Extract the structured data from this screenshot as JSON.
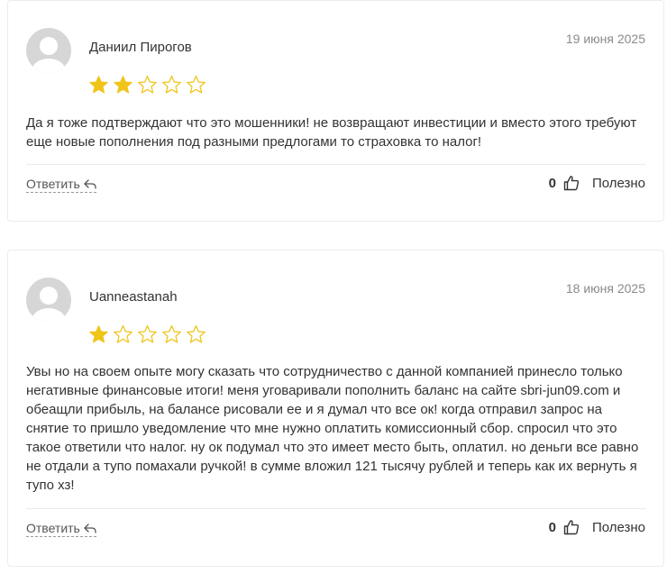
{
  "colors": {
    "star_filled": "#f0c419",
    "star_empty_stroke": "#f0c419",
    "avatar_bg": "#d6d6d6",
    "avatar_fg": "#ffffff"
  },
  "reviews": [
    {
      "author": "Даниил Пирогов",
      "date": "19 июня 2025",
      "rating": 2,
      "max_rating": 5,
      "text": "Да я тоже подтверждают что это мошенники! не возвращают инвестиции и вместо этого требуют еще новые пополнения под разными предлогами то страховка то налог!",
      "reply_label": "Ответить",
      "reply_icon": "reply-arrow-icon",
      "helpful_count": "0",
      "helpful_icon": "thumbs-up-icon",
      "helpful_label": "Полезно"
    },
    {
      "author": "Uanneastanah",
      "date": "18 июня 2025",
      "rating": 1,
      "max_rating": 5,
      "text": "Увы но на своем опыте могу сказать что сотрудничество с данной компанией принесло только негативные финансовые итоги! меня уговаривали пополнить баланс на сайте sbri-jun09.com и обеащли прибыль, на балансе рисовали ее и я думал что все ок! когда отправил запрос на снятие то пришло уведомление что мне нужно оплатить комиссионный сбор. спросил что это такое ответили что налог. ну ок подумал что это имеет место быть, оплатил. но деньги все равно не отдали а тупо помахали ручкой! в сумме вложил 121 тысячу рублей и теперь как их вернуть я тупо хз!",
      "reply_label": "Ответить",
      "reply_icon": "reply-arrow-icon",
      "helpful_count": "0",
      "helpful_icon": "thumbs-up-icon",
      "helpful_label": "Полезно"
    }
  ]
}
